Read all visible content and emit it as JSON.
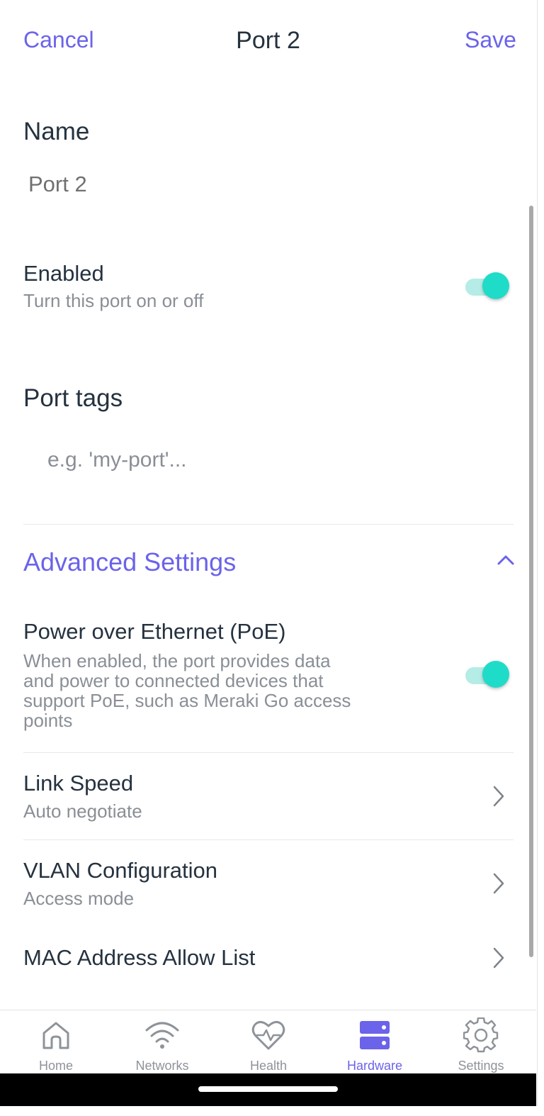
{
  "header": {
    "cancel_label": "Cancel",
    "title": "Port 2",
    "save_label": "Save"
  },
  "name_section": {
    "title": "Name",
    "value": "Port 2"
  },
  "enabled": {
    "label": "Enabled",
    "description": "Turn this port on or off",
    "state": "on"
  },
  "port_tags": {
    "title": "Port tags",
    "placeholder": "e.g. 'my-port'..."
  },
  "advanced": {
    "title": "Advanced Settings",
    "expanded": true,
    "icon": "chevron-up-icon",
    "poe": {
      "label": "Power over Ethernet (PoE)",
      "description_lines": [
        "When enabled, the port provides data",
        "and power to connected devices that",
        "support PoE, such as Meraki Go access",
        "points"
      ],
      "state": "on"
    },
    "rows": [
      {
        "label": "Link Speed",
        "value": "Auto negotiate"
      },
      {
        "label": "VLAN Configuration",
        "value": "Access mode"
      },
      {
        "label": "MAC Address Allow List",
        "value": ""
      }
    ]
  },
  "tabbar": {
    "tabs": [
      {
        "label": "Home",
        "icon": "home-icon",
        "active": false
      },
      {
        "label": "Networks",
        "icon": "wifi-icon",
        "active": false
      },
      {
        "label": "Health",
        "icon": "health-heart-icon",
        "active": false
      },
      {
        "label": "Hardware",
        "icon": "hardware-server-icon",
        "active": true
      },
      {
        "label": "Settings",
        "icon": "gear-icon",
        "active": false
      }
    ]
  },
  "colors": {
    "accent": "#6b63ea",
    "toggle_on": "#1fdcc9",
    "toggle_track": "#b5ece6",
    "text_primary": "#25323f",
    "text_secondary": "#8a8f96",
    "tab_inactive": "#8e9399"
  }
}
